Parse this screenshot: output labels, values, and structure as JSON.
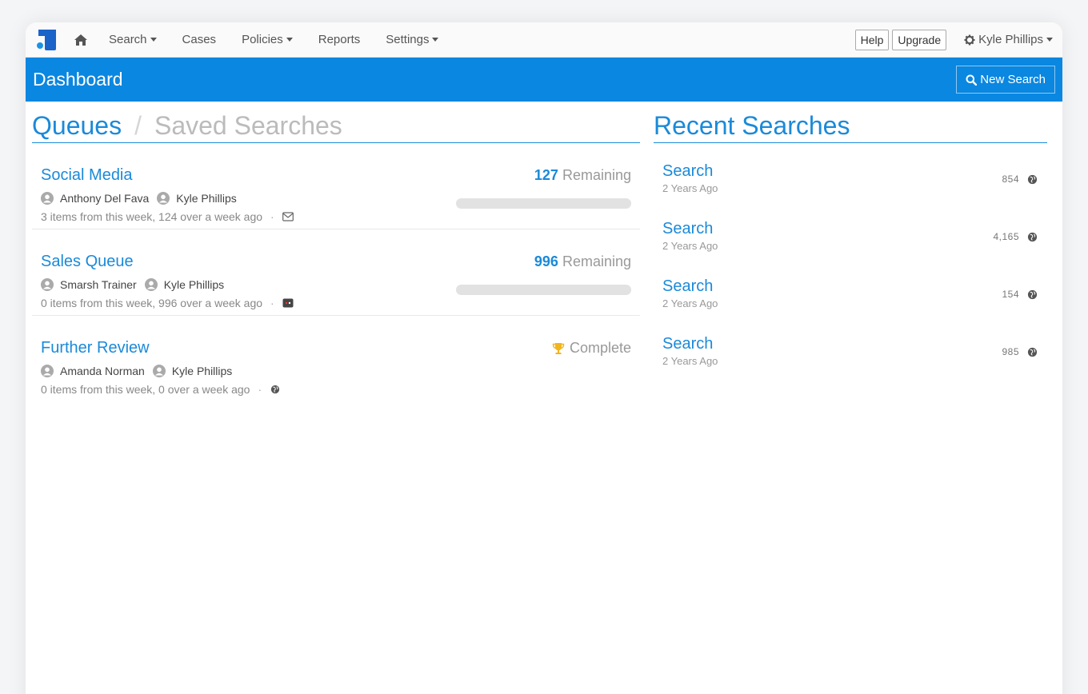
{
  "nav": {
    "items": [
      {
        "label": "Search",
        "dropdown": true
      },
      {
        "label": "Cases",
        "dropdown": false
      },
      {
        "label": "Policies",
        "dropdown": true
      },
      {
        "label": "Reports",
        "dropdown": false
      },
      {
        "label": "Settings",
        "dropdown": true
      }
    ],
    "help_label": "Help",
    "upgrade_label": "Upgrade",
    "user_name": "Kyle Phillips"
  },
  "header": {
    "title": "Dashboard",
    "new_search_label": "New Search",
    "color": "#0a87e0"
  },
  "queues_section": {
    "tab_active": "Queues",
    "tab_separator": "/",
    "tab_inactive": "Saved Searches",
    "queues": [
      {
        "name": "Social Media",
        "remaining_count": "127",
        "remaining_label": "Remaining",
        "members": [
          "Anthony Del Fava",
          "Kyle Phillips"
        ],
        "meta": "3 items from this week, 124 over a week ago",
        "meta_icon": "envelope-icon"
      },
      {
        "name": "Sales Queue",
        "remaining_count": "996",
        "remaining_label": "Remaining",
        "members": [
          "Smarsh Trainer",
          "Kyle Phillips"
        ],
        "meta": "0 items from this week, 996 over a week ago",
        "meta_icon": "chat-icon"
      },
      {
        "name": "Further Review",
        "complete_label": "Complete",
        "members": [
          "Amanda Norman",
          "Kyle Phillips"
        ],
        "meta": "0 items from this week, 0 over a week ago",
        "meta_icon": "globe-icon"
      }
    ]
  },
  "recent_section": {
    "title": "Recent Searches",
    "items": [
      {
        "title": "Search",
        "time": "2 Years Ago",
        "count": "854"
      },
      {
        "title": "Search",
        "time": "2 Years Ago",
        "count": "4,165"
      },
      {
        "title": "Search",
        "time": "2 Years Ago",
        "count": "154"
      },
      {
        "title": "Search",
        "time": "2 Years Ago",
        "count": "985"
      }
    ]
  },
  "meta_separator": "·"
}
